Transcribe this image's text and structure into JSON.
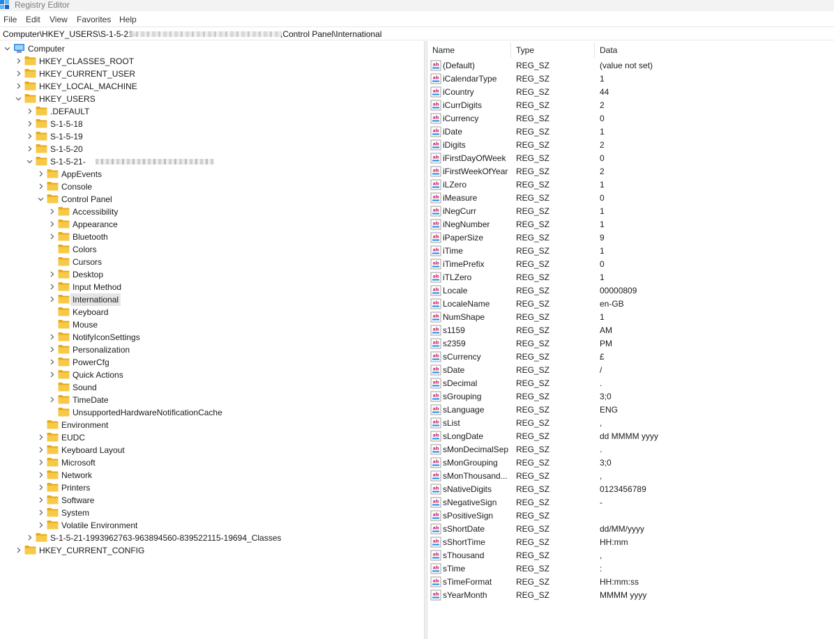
{
  "window": {
    "title": "Registry Editor",
    "icon": "registry-editor-icon"
  },
  "menu": [
    "File",
    "Edit",
    "View",
    "Favorites",
    "Help"
  ],
  "address": {
    "prefix": "Computer\\HKEY_USERS\\S-1-5-21-",
    "suffix": ",Control Panel\\International"
  },
  "tree": [
    {
      "label": "Computer",
      "level": 0,
      "expander": "expanded",
      "icon": "computer-icon"
    },
    {
      "label": "HKEY_CLASSES_ROOT",
      "level": 1,
      "expander": "collapsed"
    },
    {
      "label": "HKEY_CURRENT_USER",
      "level": 1,
      "expander": "collapsed"
    },
    {
      "label": "HKEY_LOCAL_MACHINE",
      "level": 1,
      "expander": "collapsed"
    },
    {
      "label": "HKEY_USERS",
      "level": 1,
      "expander": "expanded"
    },
    {
      "label": ".DEFAULT",
      "level": 2,
      "expander": "collapsed"
    },
    {
      "label": "S-1-5-18",
      "level": 2,
      "expander": "collapsed"
    },
    {
      "label": "S-1-5-19",
      "level": 2,
      "expander": "collapsed"
    },
    {
      "label": "S-1-5-20",
      "level": 2,
      "expander": "collapsed"
    },
    {
      "label": "S-1-5-21-",
      "level": 2,
      "expander": "expanded",
      "redacted": true
    },
    {
      "label": "AppEvents",
      "level": 3,
      "expander": "collapsed"
    },
    {
      "label": "Console",
      "level": 3,
      "expander": "collapsed"
    },
    {
      "label": "Control Panel",
      "level": 3,
      "expander": "expanded"
    },
    {
      "label": "Accessibility",
      "level": 4,
      "expander": "collapsed"
    },
    {
      "label": "Appearance",
      "level": 4,
      "expander": "collapsed"
    },
    {
      "label": "Bluetooth",
      "level": 4,
      "expander": "collapsed"
    },
    {
      "label": "Colors",
      "level": 4,
      "expander": "none"
    },
    {
      "label": "Cursors",
      "level": 4,
      "expander": "none"
    },
    {
      "label": "Desktop",
      "level": 4,
      "expander": "collapsed"
    },
    {
      "label": "Input Method",
      "level": 4,
      "expander": "collapsed"
    },
    {
      "label": "International",
      "level": 4,
      "expander": "collapsed",
      "selected": true
    },
    {
      "label": "Keyboard",
      "level": 4,
      "expander": "none"
    },
    {
      "label": "Mouse",
      "level": 4,
      "expander": "none"
    },
    {
      "label": "NotifyIconSettings",
      "level": 4,
      "expander": "collapsed"
    },
    {
      "label": "Personalization",
      "level": 4,
      "expander": "collapsed"
    },
    {
      "label": "PowerCfg",
      "level": 4,
      "expander": "collapsed"
    },
    {
      "label": "Quick Actions",
      "level": 4,
      "expander": "collapsed"
    },
    {
      "label": "Sound",
      "level": 4,
      "expander": "none"
    },
    {
      "label": "TimeDate",
      "level": 4,
      "expander": "collapsed"
    },
    {
      "label": "UnsupportedHardwareNotificationCache",
      "level": 4,
      "expander": "none"
    },
    {
      "label": "Environment",
      "level": 3,
      "expander": "none"
    },
    {
      "label": "EUDC",
      "level": 3,
      "expander": "collapsed"
    },
    {
      "label": "Keyboard Layout",
      "level": 3,
      "expander": "collapsed"
    },
    {
      "label": "Microsoft",
      "level": 3,
      "expander": "collapsed"
    },
    {
      "label": "Network",
      "level": 3,
      "expander": "collapsed"
    },
    {
      "label": "Printers",
      "level": 3,
      "expander": "collapsed"
    },
    {
      "label": "Software",
      "level": 3,
      "expander": "collapsed"
    },
    {
      "label": "System",
      "level": 3,
      "expander": "collapsed"
    },
    {
      "label": "Volatile Environment",
      "level": 3,
      "expander": "collapsed"
    },
    {
      "label": "S-1-5-21-1993962763-963894560-839522115-19694_Classes",
      "level": 2,
      "expander": "collapsed"
    },
    {
      "label": "HKEY_CURRENT_CONFIG",
      "level": 1,
      "expander": "collapsed"
    }
  ],
  "columns": {
    "name": "Name",
    "type": "Type",
    "data": "Data"
  },
  "values": [
    {
      "name": "(Default)",
      "type": "REG_SZ",
      "data": "(value not set)"
    },
    {
      "name": "iCalendarType",
      "type": "REG_SZ",
      "data": "1"
    },
    {
      "name": "iCountry",
      "type": "REG_SZ",
      "data": "44"
    },
    {
      "name": "iCurrDigits",
      "type": "REG_SZ",
      "data": "2"
    },
    {
      "name": "iCurrency",
      "type": "REG_SZ",
      "data": "0"
    },
    {
      "name": "iDate",
      "type": "REG_SZ",
      "data": "1"
    },
    {
      "name": "iDigits",
      "type": "REG_SZ",
      "data": "2"
    },
    {
      "name": "iFirstDayOfWeek",
      "type": "REG_SZ",
      "data": "0"
    },
    {
      "name": "iFirstWeekOfYear",
      "type": "REG_SZ",
      "data": "2"
    },
    {
      "name": "iLZero",
      "type": "REG_SZ",
      "data": "1"
    },
    {
      "name": "iMeasure",
      "type": "REG_SZ",
      "data": "0"
    },
    {
      "name": "iNegCurr",
      "type": "REG_SZ",
      "data": "1"
    },
    {
      "name": "iNegNumber",
      "type": "REG_SZ",
      "data": "1"
    },
    {
      "name": "iPaperSize",
      "type": "REG_SZ",
      "data": "9"
    },
    {
      "name": "iTime",
      "type": "REG_SZ",
      "data": "1"
    },
    {
      "name": "iTimePrefix",
      "type": "REG_SZ",
      "data": "0"
    },
    {
      "name": "iTLZero",
      "type": "REG_SZ",
      "data": "1"
    },
    {
      "name": "Locale",
      "type": "REG_SZ",
      "data": "00000809"
    },
    {
      "name": "LocaleName",
      "type": "REG_SZ",
      "data": "en-GB"
    },
    {
      "name": "NumShape",
      "type": "REG_SZ",
      "data": "1"
    },
    {
      "name": "s1159",
      "type": "REG_SZ",
      "data": "AM"
    },
    {
      "name": "s2359",
      "type": "REG_SZ",
      "data": "PM"
    },
    {
      "name": "sCurrency",
      "type": "REG_SZ",
      "data": "£"
    },
    {
      "name": "sDate",
      "type": "REG_SZ",
      "data": "/"
    },
    {
      "name": "sDecimal",
      "type": "REG_SZ",
      "data": "."
    },
    {
      "name": "sGrouping",
      "type": "REG_SZ",
      "data": "3;0"
    },
    {
      "name": "sLanguage",
      "type": "REG_SZ",
      "data": "ENG"
    },
    {
      "name": "sList",
      "type": "REG_SZ",
      "data": ","
    },
    {
      "name": "sLongDate",
      "type": "REG_SZ",
      "data": "dd MMMM yyyy"
    },
    {
      "name": "sMonDecimalSep",
      "type": "REG_SZ",
      "data": "."
    },
    {
      "name": "sMonGrouping",
      "type": "REG_SZ",
      "data": "3;0"
    },
    {
      "name": "sMonThousand...",
      "type": "REG_SZ",
      "data": ","
    },
    {
      "name": "sNativeDigits",
      "type": "REG_SZ",
      "data": "0123456789"
    },
    {
      "name": "sNegativeSign",
      "type": "REG_SZ",
      "data": "-"
    },
    {
      "name": "sPositiveSign",
      "type": "REG_SZ",
      "data": ""
    },
    {
      "name": "sShortDate",
      "type": "REG_SZ",
      "data": "dd/MM/yyyy"
    },
    {
      "name": "sShortTime",
      "type": "REG_SZ",
      "data": "HH:mm"
    },
    {
      "name": "sThousand",
      "type": "REG_SZ",
      "data": ","
    },
    {
      "name": "sTime",
      "type": "REG_SZ",
      "data": ":"
    },
    {
      "name": "sTimeFormat",
      "type": "REG_SZ",
      "data": "HH:mm:ss"
    },
    {
      "name": "sYearMonth",
      "type": "REG_SZ",
      "data": "MMMM yyyy"
    }
  ],
  "colors": {
    "folder": "#f7c948",
    "folder_dark": "#e8a917",
    "selection": "#e5e5e5",
    "value_icon": "#c2185b",
    "computer_icon": "#2b88d8"
  }
}
